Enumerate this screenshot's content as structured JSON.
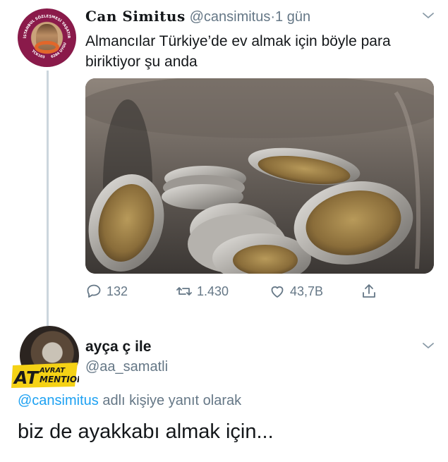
{
  "tweet": {
    "author_name": "Can Simitus",
    "author_handle": "@cansimitus",
    "separator": "·",
    "time": "1 gün",
    "text": "Almancılar Türkiye’de ev almak için böyle para biriktiyor şu anda",
    "avatar_ring_text": "İSTANBUL SÖZLEŞMESİ YAŞATIR",
    "avatar_ring_bottom_left": "TCK103",
    "avatar_ring_bottom_right": "6284 UYGULA",
    "actions": {
      "replies": "132",
      "retweets": "1.430",
      "likes": "43,7B"
    },
    "icons": [
      "reply-icon",
      "retweet-icon",
      "like-icon",
      "share-icon",
      "chevron-down-icon"
    ]
  },
  "reply": {
    "author_name": "ayça ç ile",
    "author_handle": "@aa_samatli",
    "badge_text_1": "AT",
    "badge_text_2": "AVRAT",
    "badge_text_3": "MENTION",
    "reply_prefix_mention": "@cansimitus",
    "reply_prefix_rest": " adlı kişiye yanıt olarak",
    "text": "biz de ayakkabı almak için..."
  },
  "colors": {
    "text": "#14171a",
    "secondary": "#657786",
    "link": "#1da1f2",
    "thread_line": "#ccd6dd",
    "badge_yellow": "#f5d215"
  }
}
